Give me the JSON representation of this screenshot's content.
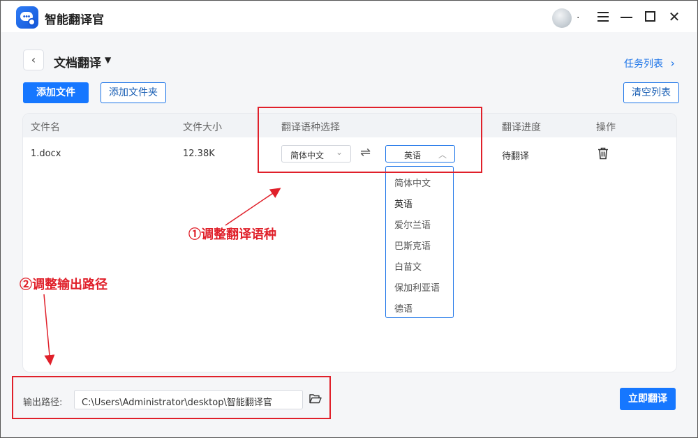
{
  "app": {
    "title": "智能翻译官",
    "avatar_suffix": "."
  },
  "header": {
    "page_title": "文档翻译",
    "task_list": "任务列表",
    "task_list_chevron": "›",
    "back_icon": "‹",
    "title_caret": "▼"
  },
  "toolbar": {
    "add_file": "添加文件",
    "add_folder": "添加文件夹",
    "clear_list": "清空列表"
  },
  "table": {
    "columns": [
      "文件名",
      "文件大小",
      "翻译语种选择",
      "翻译进度",
      "操作"
    ],
    "rows": [
      {
        "filename": "1.docx",
        "size": "12.38K",
        "source_lang": "简体中文",
        "target_lang": "英语",
        "progress": "待翻译"
      }
    ]
  },
  "language_dropdown": {
    "options": [
      "简体中文",
      "英语",
      "爱尔兰语",
      "巴斯克语",
      "白苗文",
      "保加利亚语",
      "德语"
    ],
    "selected": "英语"
  },
  "annotations": {
    "step1": "①调整翻译语种",
    "step2": "②调整输出路径"
  },
  "footer": {
    "output_label": "输出路径:",
    "output_path": "C:\\Users\\Administrator\\desktop\\智能翻译官",
    "translate_now": "立即翻译"
  },
  "colors": {
    "accent": "#1677ff",
    "annotation_red": "#e0202a",
    "background": "#f5f6f8"
  },
  "icons": [
    "app-logo-icon",
    "menu-icon",
    "minimize-icon",
    "maximize-icon",
    "close-icon",
    "back-icon",
    "caret-down-icon",
    "chevron-right-icon",
    "chevron-down-icon",
    "chevron-up-icon",
    "swap-icon",
    "trash-icon",
    "folder-icon"
  ]
}
